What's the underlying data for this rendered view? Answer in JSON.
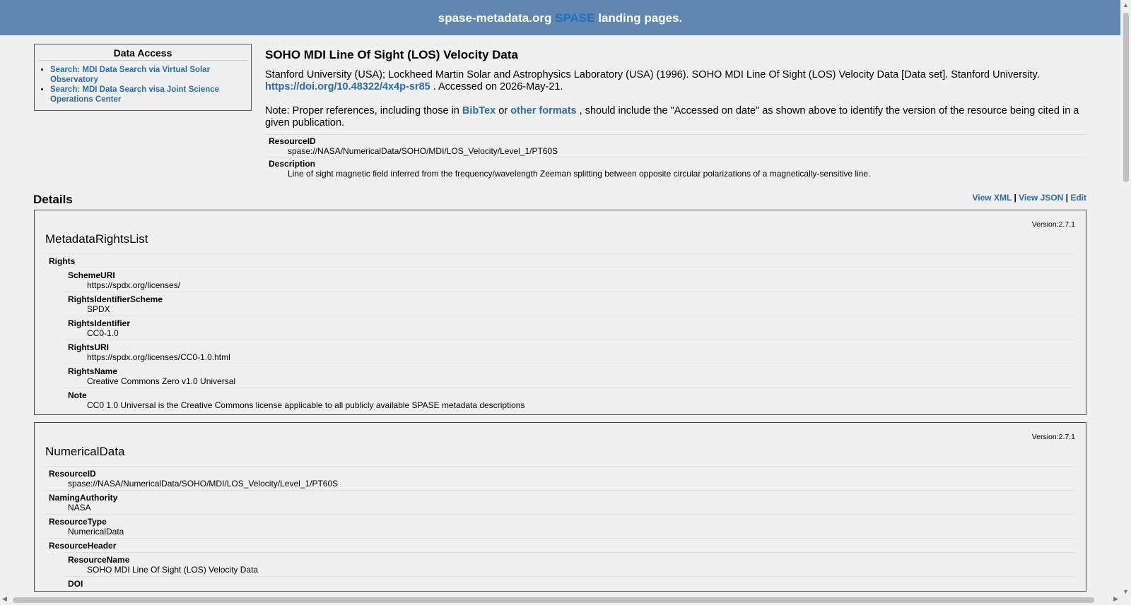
{
  "header": {
    "prefix": "spase-metadata.org",
    "brand": "SPASE",
    "suffix": "landing pages."
  },
  "sidebar": {
    "title": "Data Access",
    "links": [
      "Search: MDI Data Search via Virtual Solar Observatory",
      "Search: MDI Data Search visa Joint Science Operations Center"
    ]
  },
  "resource": {
    "title": "SOHO MDI Line Of Sight (LOS) Velocity Data",
    "citation_text": "Stanford University (USA); Lockheed Martin Solar and Astrophysics Laboratory (USA) (1996). SOHO MDI Line Of Sight (LOS) Velocity Data [Data set]. Stanford University.",
    "doi_link": "https://doi.org/10.48322/4x4p-sr85",
    "accessed": ". Accessed on 2026-May-21.",
    "note_prefix": "Note: Proper references, including those in",
    "bibtex": "BibTex",
    "or": "or",
    "other_formats": "other formats",
    "note_suffix": ", should include the \"Accessed on date\" as shown above to identify the version of the resource being cited in a given publication.",
    "resource_id_label": "ResourceID",
    "resource_id": "spase://NASA/NumericalData/SOHO/MDI/LOS_Velocity/Level_1/PT60S",
    "description_label": "Description",
    "description": "Line of sight magnetic field inferred from the frequency/wavelength Zeeman splitting between opposite circular polarizations of a magnetically-sensitive line."
  },
  "details": {
    "title": "Details",
    "view_xml": "View XML",
    "view_json": "View JSON",
    "edit": "Edit",
    "sep": "|"
  },
  "rights_box": {
    "version": "Version:2.7.1",
    "title": "MetadataRightsList",
    "rights_label": "Rights",
    "fields": [
      {
        "k": "SchemeURI",
        "v": "https://spdx.org/licenses/"
      },
      {
        "k": "RightsIdentifierScheme",
        "v": "SPDX"
      },
      {
        "k": "RightsIdentifier",
        "v": "CC0-1.0"
      },
      {
        "k": "RightsURI",
        "v": "https://spdx.org/licenses/CC0-1.0.html"
      },
      {
        "k": "RightsName",
        "v": "Creative Commons Zero v1.0 Universal"
      },
      {
        "k": "Note",
        "v": "CC0 1.0 Universal is the Creative Commons license applicable to all publicly available SPASE metadata descriptions"
      }
    ]
  },
  "numerical_box": {
    "version": "Version:2.7.1",
    "title": "NumericalData",
    "fields": [
      {
        "k": "ResourceID",
        "v": "spase://NASA/NumericalData/SOHO/MDI/LOS_Velocity/Level_1/PT60S"
      },
      {
        "k": "NamingAuthority",
        "v": "NASA"
      },
      {
        "k": "ResourceType",
        "v": "NumericalData"
      }
    ],
    "header_label": "ResourceHeader",
    "header_fields": [
      {
        "k": "ResourceName",
        "v": "SOHO MDI Line Of Sight (LOS) Velocity Data"
      },
      {
        "k": "DOI",
        "v": ""
      }
    ]
  }
}
